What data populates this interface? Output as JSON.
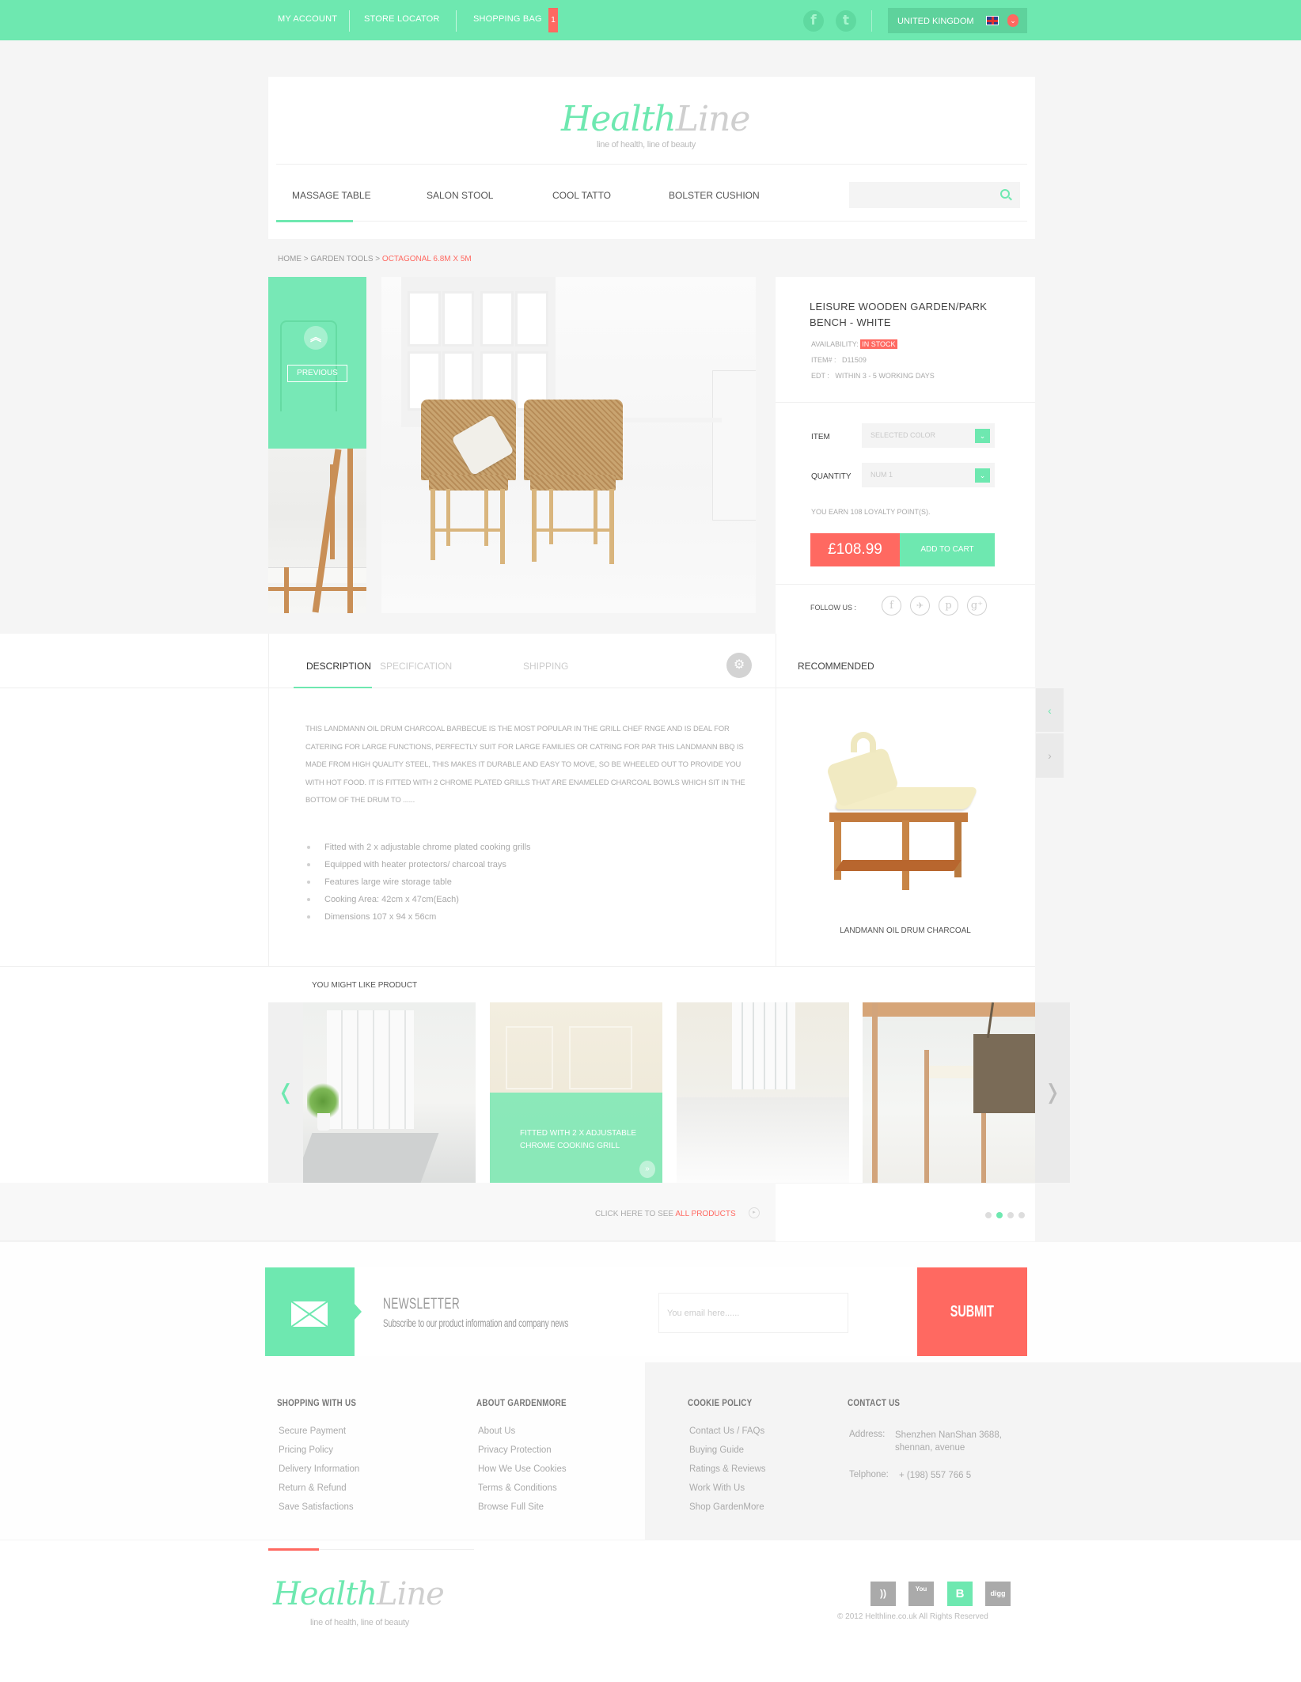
{
  "topbar": {
    "links": [
      "MY ACCOUNT",
      "STORE LOCATOR",
      "SHOPPING BAG"
    ],
    "bag_count": "1",
    "social": [
      {
        "icon": "facebook-icon",
        "glyph": "f"
      },
      {
        "icon": "twitter-icon",
        "glyph": "t"
      }
    ],
    "country": "UNITED KINGDOM",
    "country_caret": "⌄"
  },
  "header": {
    "logo_part1": "Health",
    "logo_part2": "Line",
    "tagline": "line of health, line of beauty",
    "nav": [
      "MASSAGE TABLE",
      "SALON STOOL",
      "COOL TATTO",
      "BOLSTER CUSHION"
    ],
    "active_nav": "MASSAGE TABLE",
    "search_placeholder": ""
  },
  "breadcrumb": {
    "items": [
      "HOME",
      "GARDEN TOOLS"
    ],
    "separator": ">",
    "current": "OCTAGONAL 6.8M X 5M"
  },
  "gallery": {
    "up_glyph": "︽",
    "previous_label": "PREVIOUS"
  },
  "product": {
    "title": "LEISURE WOODEN GARDEN/PARK BENCH - WHITE",
    "availability_label": "AVAILABILITY:",
    "availability_value": "IN STOCK",
    "item_label": "ITEM# :",
    "item_value": "D11509",
    "edt_label": "EDT :",
    "edt_value": "WITHIN 3 - 5 WORKING DAYS",
    "item_field_label": "ITEM",
    "item_select_value": "SELECTED COLOR",
    "quantity_label": "QUANTITY",
    "quantity_select_value": "NUM 1",
    "loyalty": "YOU EARN 108 LOYALTY POINT(S).",
    "price": "£108.99",
    "add_to_cart": "ADD TO CART",
    "follow_label": "FOLLOW US :",
    "follow_icons": [
      {
        "icon": "facebook-icon",
        "glyph": "f"
      },
      {
        "icon": "twitter-icon",
        "glyph": "✈"
      },
      {
        "icon": "pinterest-icon",
        "glyph": "p"
      },
      {
        "icon": "google-plus-icon",
        "glyph": "g⁺"
      }
    ]
  },
  "tabs": {
    "items": [
      "DESCRIPTION",
      "SPECIFICATION",
      "SHIPPING"
    ],
    "active": "DESCRIPTION",
    "gear_glyph": "⚙"
  },
  "description": {
    "paragraph": "THIS LANDMANN OIL DRUM CHARCOAL BARBECUE IS THE MOST POPULAR IN THE GRILL CHEF RNGE AND IS DEAL FOR CATERING FOR LARGE FUNCTIONS, PERFECTLY SUIT FOR LARGE FAMILIES OR CATRING FOR PAR THIS LANDMANN BBQ IS MADE FROM HIGH QUALITY STEEL, THIS MAKES IT DURABLE AND EASY TO MOVE, SO BE WHEELED OUT TO PROVIDE YOU WITH HOT FOOD. IT IS FITTED WITH 2 CHROME PLATED GRILLS THAT ARE ENAMELED CHARCOAL BOWLS WHICH SIT IN THE BOTTOM OF THE DRUM TO ......",
    "bullets": [
      "Fitted with 2 x adjustable chrome plated cooking grills",
      "Equipped with heater protectors/ charcoal trays",
      "Features large wire storage table",
      "Cooking Area: 42cm x 47cm(Each)",
      "Dimensions 107 x 94 x 56cm"
    ]
  },
  "recommended": {
    "title": "RECOMMENDED",
    "caption": "LANDMANN OIL DRUM CHARCOAL",
    "prev_glyph": "‹",
    "next_glyph": "›"
  },
  "might_like": {
    "title": "YOU MIGHT LIKE PRODUCT",
    "prev_glyph": "❬",
    "next_glyph": "❭",
    "overlay_text_line1": "FITTED WITH 2 X ADJUSTABLE",
    "overlay_text_line2": "CHROME COOKING GRILL",
    "overlay_more_glyph": "»",
    "see_all_prefix": "CLICK HERE TO SEE",
    "see_all_link": "ALL PRODUCTS",
    "see_all_glyph": "▸",
    "pager_total": 4,
    "pager_active": 2
  },
  "newsletter": {
    "title": "NEWSLETTER",
    "subtitle": "Subscribe to our product information and company news",
    "email_placeholder": "You email here......",
    "submit": "SUBMIT"
  },
  "footer": {
    "columns": [
      {
        "heading": "SHOPPING WITH US",
        "links": [
          "Secure Payment",
          "Pricing Policy",
          "Delivery Information",
          "Return & Refund",
          "Save Satisfactions"
        ]
      },
      {
        "heading": "ABOUT GARDENMORE",
        "links": [
          "About Us",
          "Privacy Protection",
          "How We Use Cookies",
          "Terms & Conditions",
          "Browse Full Site"
        ]
      },
      {
        "heading": "COOKIE POLICY",
        "links": [
          "Contact Us / FAQs",
          "Buying Guide",
          "Ratings & Reviews",
          "Work With Us",
          "Shop  GardenMore"
        ]
      }
    ],
    "contact": {
      "heading": "CONTACT US",
      "address_label": "Address:",
      "address_line1": "Shenzhen NanShan  3688,",
      "address_line2": "shennan, avenue",
      "phone_label": "Telphone:",
      "phone_value": "+ (198) 557 766 5"
    },
    "logo_part1": "Health",
    "logo_part2": "Line",
    "tagline": "line of health, line of beauty",
    "social": [
      {
        "icon": "rss-icon",
        "glyph": "))"
      },
      {
        "icon": "youtube-icon",
        "glyph": "You"
      },
      {
        "icon": "blogger-icon",
        "glyph": "B"
      },
      {
        "icon": "digg-icon",
        "glyph": "digg"
      }
    ],
    "copyright": "© 2012 Helthline.co.uk All Rights  Reserved"
  },
  "colors": {
    "accent_green": "#6ee8b0",
    "accent_red": "#ff6961",
    "background": "#f5f5f5"
  }
}
